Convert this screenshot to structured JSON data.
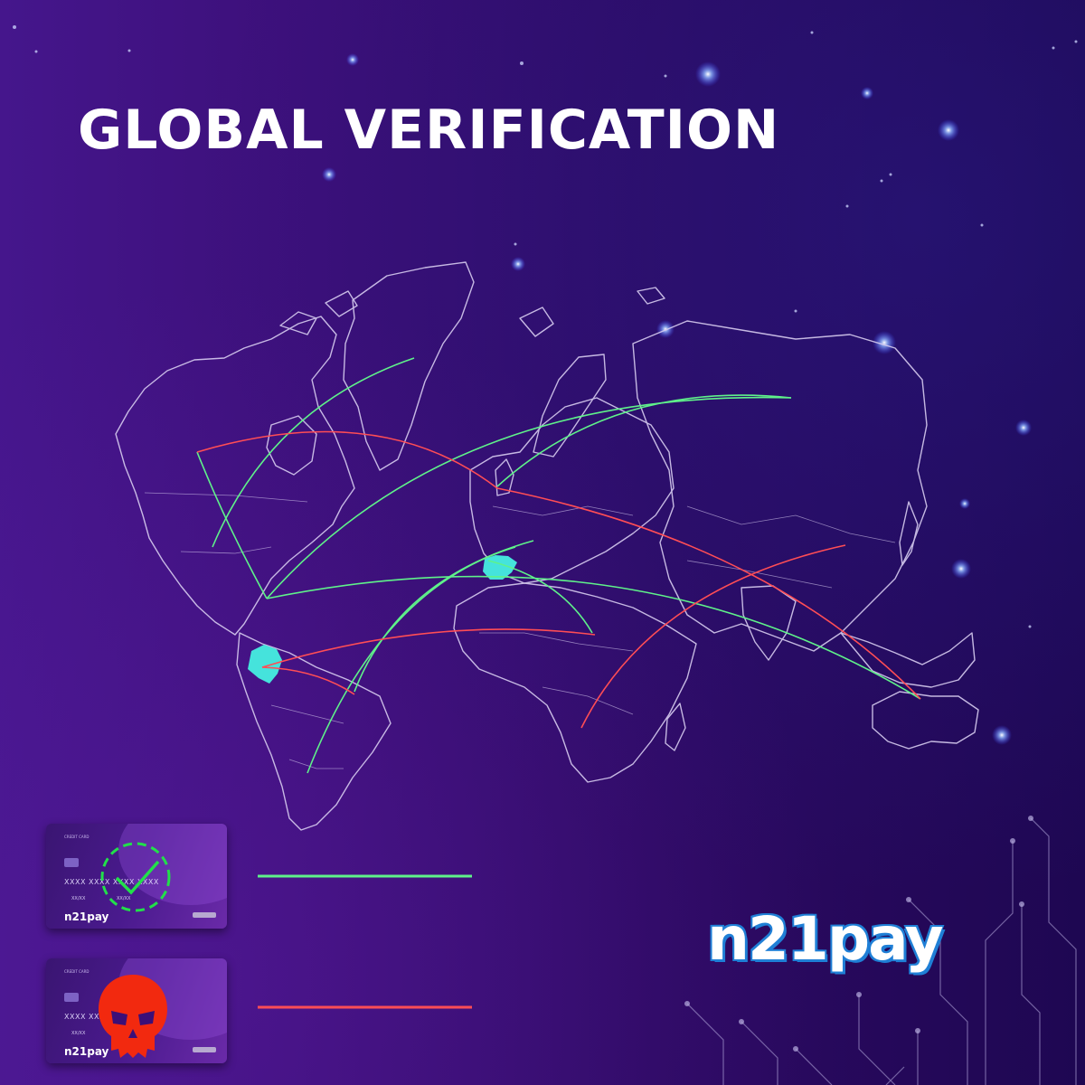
{
  "title": "GLOBAL VERIFICATION",
  "brand": {
    "logo_text": "n21pay"
  },
  "colors": {
    "approved": "#5ff28a",
    "rejected": "#ff4d55",
    "highlight": "#45e3dc",
    "map_outline": "#d7ccf0",
    "logo_outline": "#1f7fd6",
    "skull": "#f2290f"
  },
  "legend": [
    {
      "status": "approved",
      "icon": "check-circle-icon",
      "card": {
        "type_label": "CREDIT CARD",
        "number": "XXXX XXXX XXXX XXXX",
        "expiry_left": "XX/XX",
        "expiry_right": "XX/XX",
        "brand": "n21pay"
      }
    },
    {
      "status": "rejected",
      "icon": "skull-icon",
      "card": {
        "type_label": "CREDIT CARD",
        "number": "XXXX XXXX XXXX XXXX",
        "expiry_left": "XX/XX",
        "brand": "n21pay"
      }
    }
  ]
}
